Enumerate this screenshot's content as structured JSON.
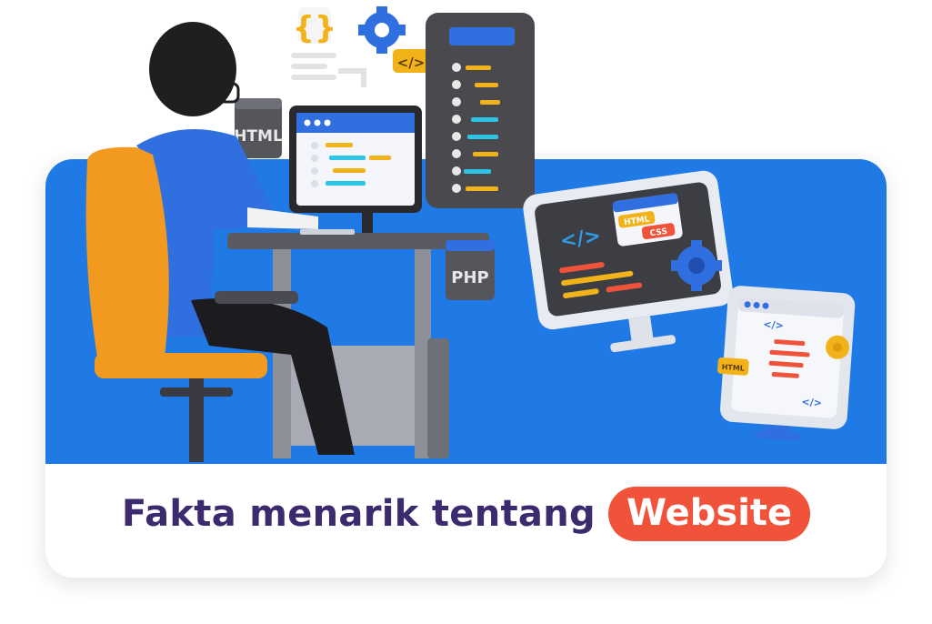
{
  "banner": {
    "title_main": "Fakta menarik tentang",
    "title_highlight": "Website"
  },
  "tags": {
    "html_tag": "HTML",
    "php_tag": "PHP",
    "css_tag": "CSS",
    "code_symbol": "</>",
    "braces_symbol": "{}"
  },
  "colors": {
    "banner_blue": "#1f7ae6",
    "title_purple": "#3b2a6e",
    "highlight_orange": "#f0533a",
    "chair_orange": "#f29a1f",
    "shirt_blue": "#2f6fe0"
  },
  "icons": [
    "gear-icon",
    "code-icon",
    "braces-icon"
  ]
}
